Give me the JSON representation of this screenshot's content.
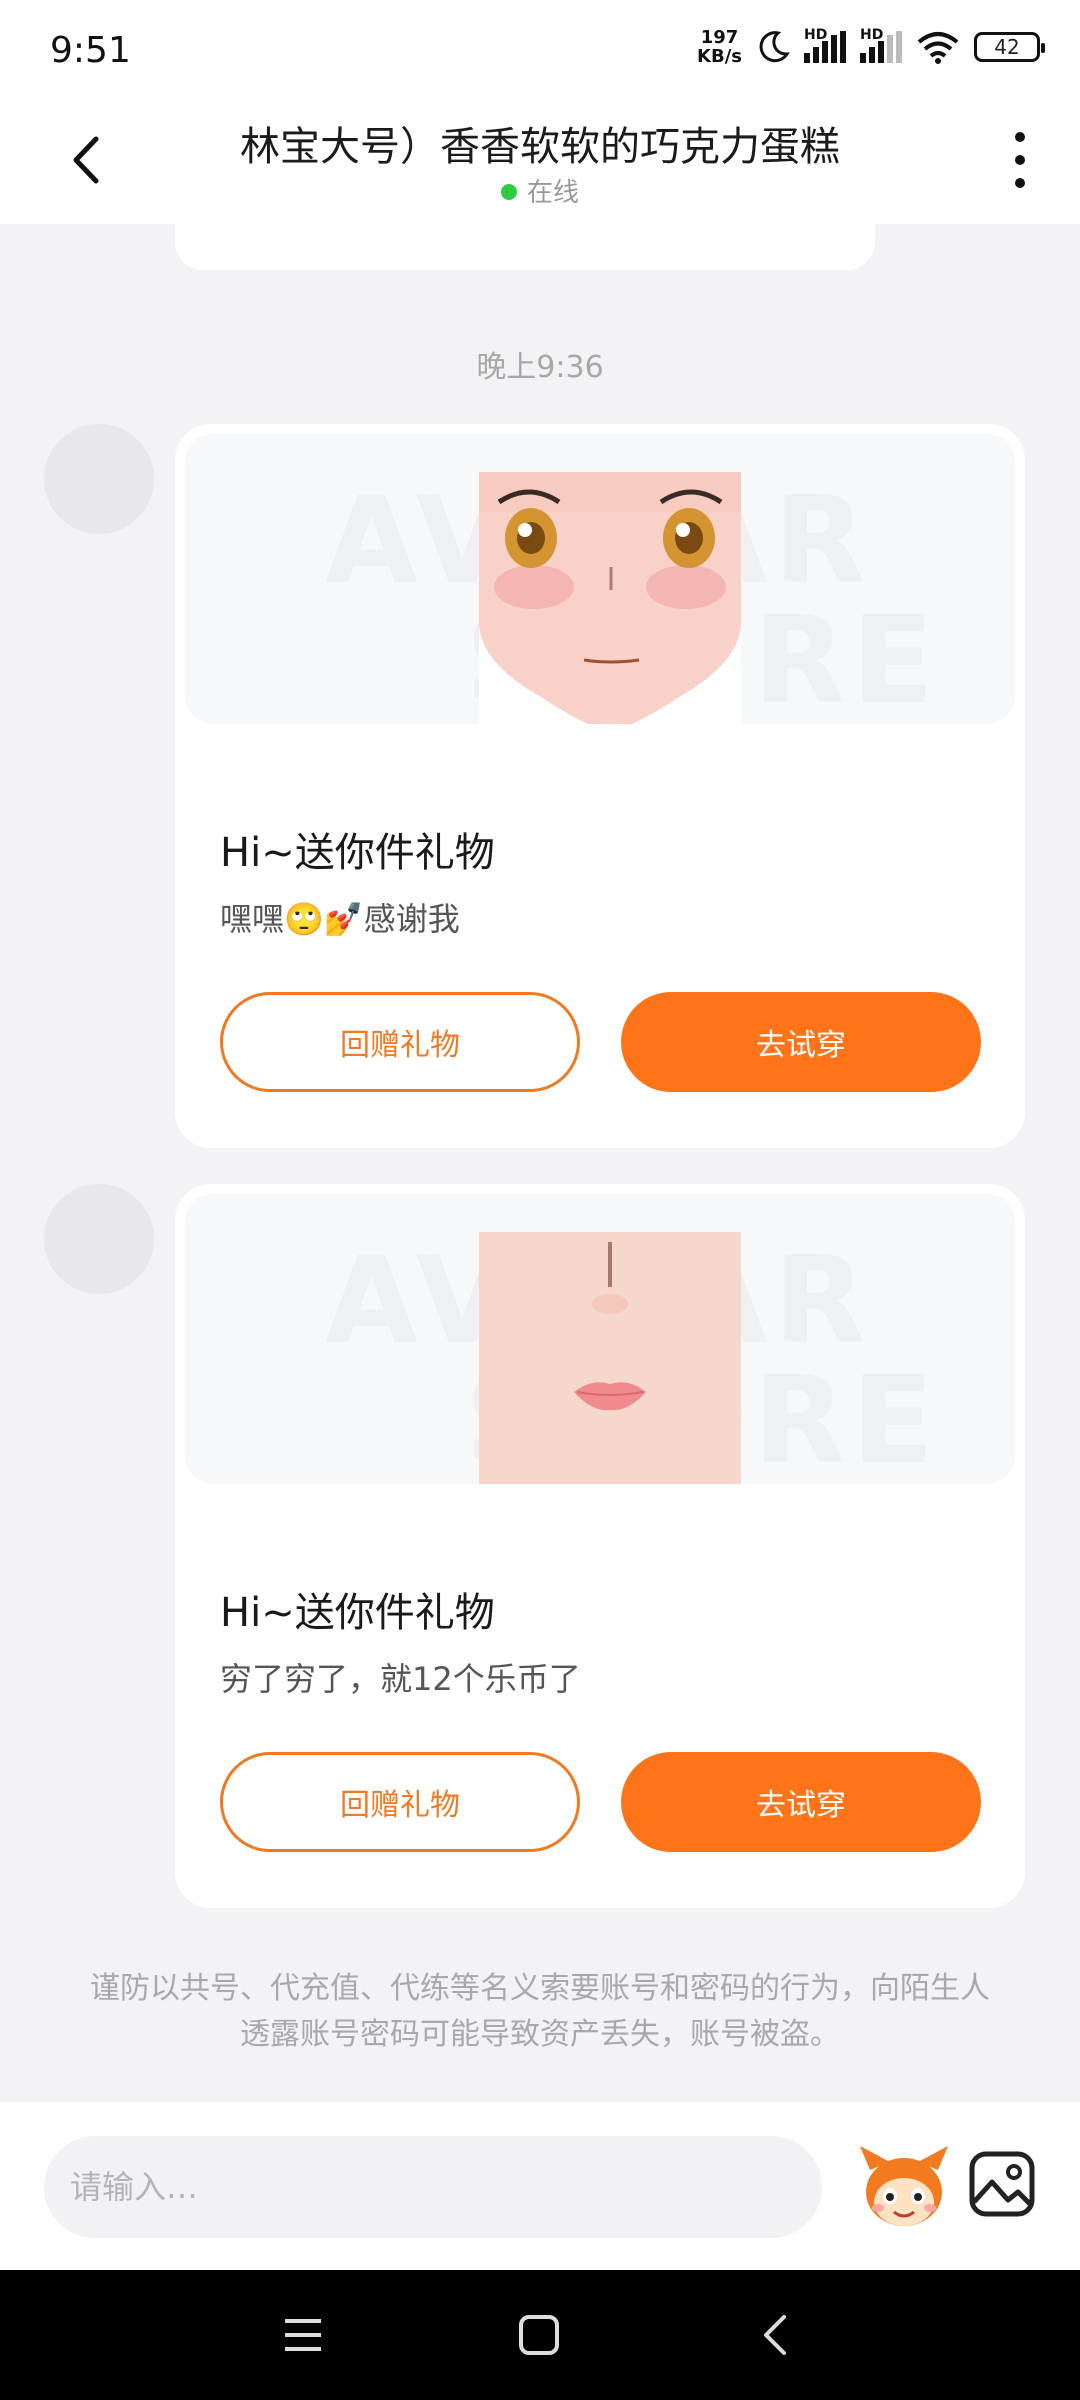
{
  "status_bar": {
    "time": "9:51",
    "net_speed_value": "197",
    "net_speed_unit": "KB/s",
    "signal_label": "HD",
    "battery": "42"
  },
  "header": {
    "title": "林宝大号）香香软软的巧克力蛋糕",
    "status": "在线"
  },
  "chat": {
    "timestamp": "晚上9:36",
    "watermark_line1": "AVATAR",
    "watermark_line2": "STORE",
    "messages": [
      {
        "title": "Hi~送你件礼物",
        "text": "嘿嘿🙄💅感谢我",
        "item": "face",
        "return_gift_label": "回赠礼物",
        "try_on_label": "去试穿"
      },
      {
        "title": "Hi~送你件礼物",
        "text": "穷了穷了，就12个乐币了",
        "item": "mouth",
        "return_gift_label": "回赠礼物",
        "try_on_label": "去试穿"
      }
    ],
    "notice": "谨防以共号、代充值、代练等名义索要账号和密码的行为，向陌生人透露账号密码可能导致资产丢失，账号被盗。"
  },
  "input": {
    "placeholder": "请输入…"
  },
  "icons": {
    "back": "back-arrow-icon",
    "more": "more-vertical-icon",
    "emoji": "mascot-emoji-icon",
    "image": "image-icon"
  },
  "colors": {
    "accent": "#ff7418",
    "accent_outline": "#ef7a22",
    "online": "#2ecc40",
    "background": "#f3f3f6"
  }
}
